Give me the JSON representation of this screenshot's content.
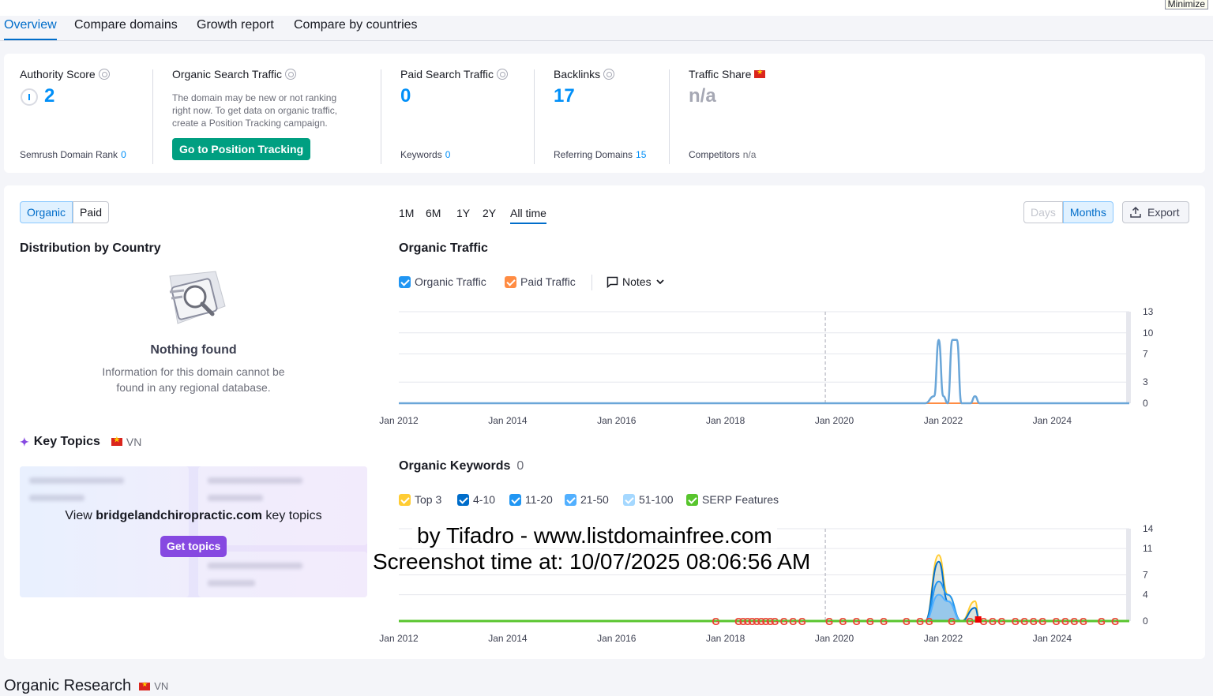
{
  "window": {
    "minimize_label": "Minimize"
  },
  "tabs": [
    {
      "label": "Overview",
      "active": true
    },
    {
      "label": "Compare domains"
    },
    {
      "label": "Growth report"
    },
    {
      "label": "Compare by countries"
    }
  ],
  "metrics": {
    "authority": {
      "label": "Authority Score",
      "value": "2",
      "sub_label": "Semrush Domain Rank",
      "sub_value": "0"
    },
    "organic": {
      "label": "Organic Search Traffic",
      "desc_lines": [
        "The domain may be new or not ranking",
        "right now. To get data on organic traffic,",
        "create a Position Tracking campaign."
      ],
      "button": "Go to Position Tracking"
    },
    "paid": {
      "label": "Paid Search Traffic",
      "value": "0",
      "sub_label": "Keywords",
      "sub_value": "0"
    },
    "backlinks": {
      "label": "Backlinks",
      "value": "17",
      "sub_label": "Referring Domains",
      "sub_value": "15"
    },
    "share": {
      "label": "Traffic Share",
      "value": "n/a",
      "sub_label": "Competitors",
      "sub_value": "n/a"
    }
  },
  "toggle": {
    "organic": "Organic",
    "paid": "Paid"
  },
  "periods": [
    "1M",
    "6M",
    "1Y",
    "2Y",
    "All time"
  ],
  "granularity": {
    "days": "Days",
    "months": "Months"
  },
  "export_label": "Export",
  "distribution": {
    "title": "Distribution by Country",
    "empty_title": "Nothing found",
    "empty_lines": [
      "Information for this domain cannot be",
      "found in any regional database."
    ]
  },
  "key_topics": {
    "title": "Key Topics",
    "country": "VN",
    "view_prefix": "View ",
    "domain": "bridgelandchiropractic.com",
    "view_suffix": " key topics",
    "button": "Get topics"
  },
  "organic_traffic": {
    "title": "Organic Traffic",
    "legend": {
      "organic": "Organic Traffic",
      "paid": "Paid Traffic",
      "notes": "Notes"
    }
  },
  "organic_keywords": {
    "title": "Organic Keywords",
    "count": "0",
    "legend": [
      "Top 3",
      "4-10",
      "11-20",
      "21-50",
      "51-100",
      "SERP Features"
    ]
  },
  "watermark": {
    "line1": "by Tifadro - www.listdomainfree.com",
    "line2": "Screenshot time at: 10/07/2025 08:06:56 AM"
  },
  "organic_research": {
    "title": "Organic Research",
    "country": "VN"
  },
  "colors": {
    "organic": "#008ff8",
    "paid": "#ff8c43",
    "top3": "#ffcc33",
    "r4_10": "#006dca",
    "r11_20": "#2196f3",
    "r21_50": "#52b0ff",
    "r51_100": "#a5d8ff",
    "serp": "#58c52d",
    "accent": "#006dca",
    "green_button": "#009f81",
    "purple_button": "#8649e1"
  },
  "chart_data": [
    {
      "type": "line",
      "title": "Organic Traffic",
      "x_ticks": [
        "Jan 2012",
        "Jan 2014",
        "Jan 2016",
        "Jan 2018",
        "Jan 2020",
        "Jan 2022",
        "Jan 2024"
      ],
      "y_ticks": [
        0,
        3,
        7,
        10,
        13
      ],
      "ylim": [
        0,
        13
      ],
      "series": [
        {
          "name": "Organic Traffic",
          "x": [
            "2012-01",
            "2021-09",
            "2021-11",
            "2021-12",
            "2022-01",
            "2022-02",
            "2022-03",
            "2022-04",
            "2022-05",
            "2022-07",
            "2022-08",
            "2022-09",
            "2025-06"
          ],
          "values": [
            0,
            0,
            1,
            9,
            1,
            0,
            9,
            9,
            0,
            0,
            1,
            0,
            0
          ]
        },
        {
          "name": "Paid Traffic",
          "x": [
            "2012-01",
            "2025-06"
          ],
          "values": [
            0,
            0
          ]
        }
      ]
    },
    {
      "type": "area",
      "title": "Organic Keywords",
      "x_ticks": [
        "Jan 2012",
        "Jan 2014",
        "Jan 2016",
        "Jan 2018",
        "Jan 2020",
        "Jan 2022",
        "Jan 2024"
      ],
      "y_ticks": [
        0,
        4,
        7,
        11,
        14
      ],
      "ylim": [
        0,
        14
      ],
      "series": [
        {
          "name": "Top 3",
          "x": [
            "2021-09",
            "2021-12",
            "2022-02",
            "2022-05",
            "2022-08",
            "2022-09"
          ],
          "values": [
            0,
            10,
            4,
            0,
            3,
            0
          ]
        },
        {
          "name": "4-10",
          "x": [
            "2021-09",
            "2021-12",
            "2022-02",
            "2022-05",
            "2022-08",
            "2022-09"
          ],
          "values": [
            0,
            9,
            3,
            0,
            2,
            0
          ]
        },
        {
          "name": "11-20",
          "x": [
            "2021-09",
            "2021-12",
            "2022-02",
            "2022-05"
          ],
          "values": [
            0,
            6,
            4,
            0
          ]
        },
        {
          "name": "21-50",
          "x": [
            "2021-09",
            "2021-12",
            "2022-02",
            "2022-05"
          ],
          "values": [
            0,
            4,
            3,
            0
          ]
        }
      ]
    }
  ]
}
